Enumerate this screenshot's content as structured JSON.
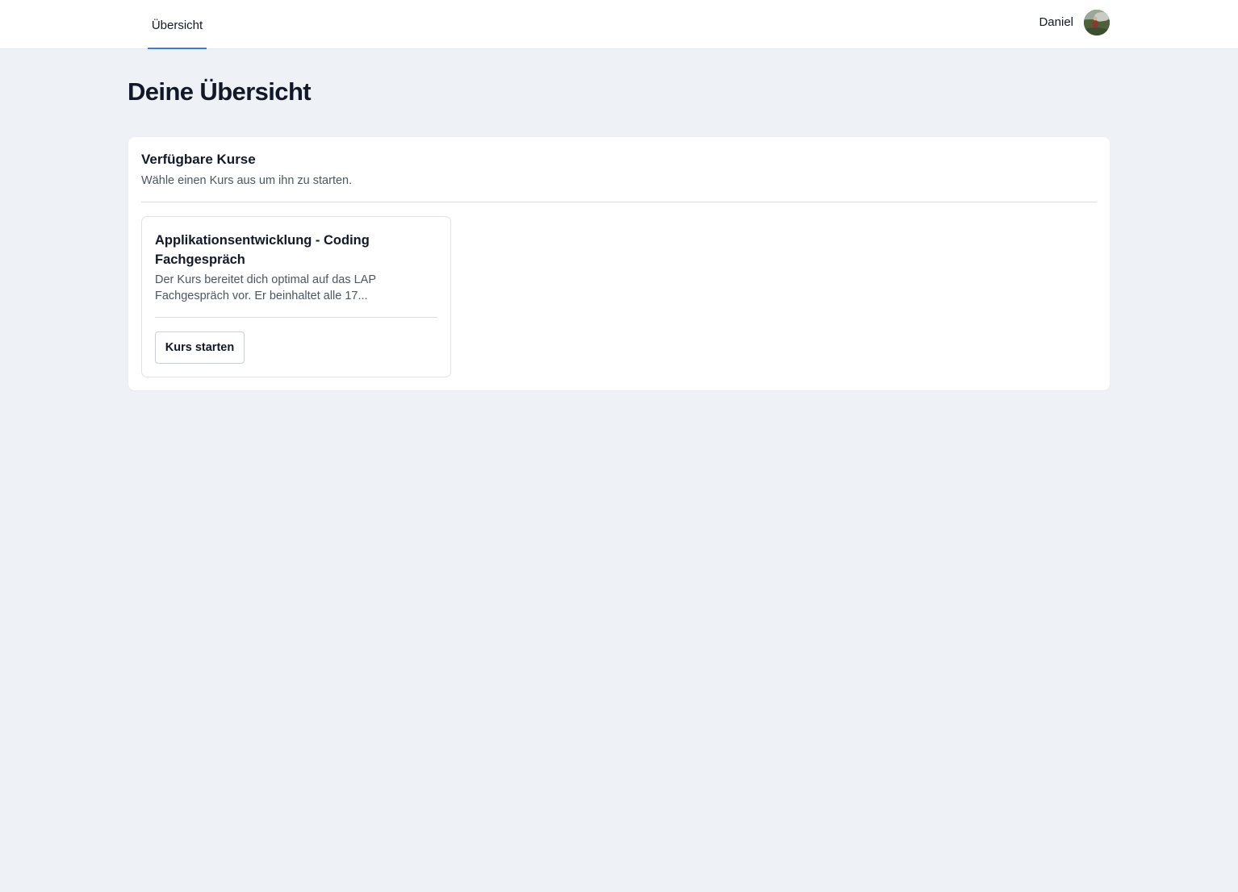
{
  "nav": {
    "tabs": [
      {
        "label": "Übersicht",
        "active": true
      }
    ],
    "active_color": "#3b7ddd"
  },
  "user": {
    "name": "Daniel",
    "avatar_icon": "user-avatar-photo"
  },
  "page": {
    "title": "Deine Übersicht"
  },
  "courses_panel": {
    "title": "Verfügbare Kurse",
    "subtitle": "Wähle einen Kurs aus um ihn zu starten.",
    "courses": [
      {
        "title": "Applikationsentwicklung - Coding Fachgespräch",
        "description": "Der Kurs bereitet dich optimal auf das LAP Fachgespräch vor. Er beinhaltet alle 17...",
        "button_label": "Kurs starten"
      }
    ]
  }
}
